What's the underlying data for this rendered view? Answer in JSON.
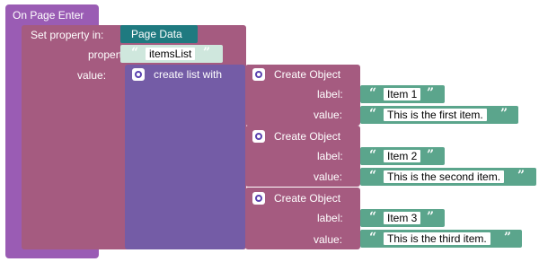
{
  "event": {
    "label": "On Page Enter"
  },
  "set_property": {
    "label": "Set property in:",
    "target": "Page Data",
    "property_label": "property:",
    "property_value": "itemsList",
    "value_label": "value:"
  },
  "list": {
    "label": "create list with"
  },
  "objects": [
    {
      "title": "Create Object",
      "label_key": "label:",
      "label_value": "Item 1",
      "value_key": "value:",
      "value_value": "This is the first item."
    },
    {
      "title": "Create Object",
      "label_key": "label:",
      "label_value": "Item 2",
      "value_key": "value:",
      "value_value": "This is the second item."
    },
    {
      "title": "Create Object",
      "label_key": "label:",
      "label_value": "Item 3",
      "value_key": "value:",
      "value_value": "This is the third item."
    }
  ],
  "colors": {
    "event": "#9a5cb4",
    "set_property": "#a55b80",
    "page_data": "#1f7a80",
    "list": "#745ca6",
    "object": "#a55b80",
    "string": "#5ba58c",
    "string_light": "#cfe7dd"
  },
  "icons": [
    "gear-icon",
    "open-quote-icon",
    "close-quote-icon"
  ]
}
